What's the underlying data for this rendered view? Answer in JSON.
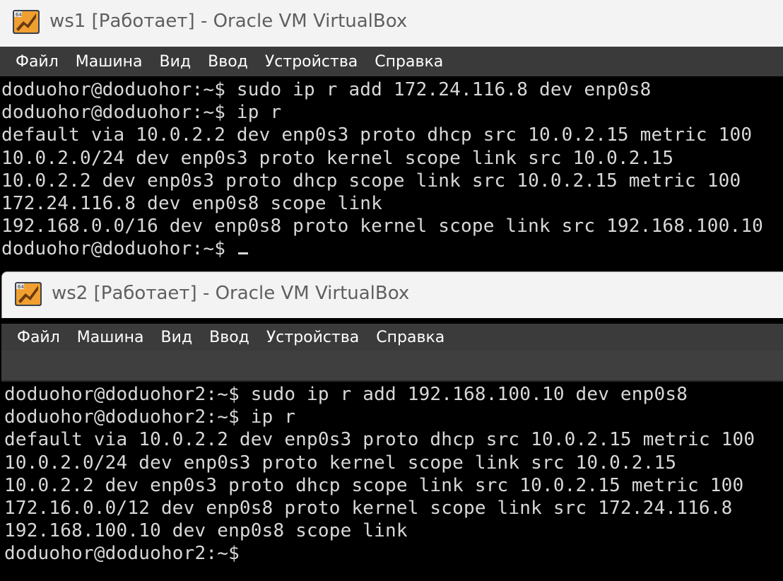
{
  "windows": [
    {
      "title": "ws1 [Работает] - Oracle VM VirtualBox",
      "menu": [
        "Файл",
        "Машина",
        "Вид",
        "Ввод",
        "Устройства",
        "Справка"
      ],
      "terminal": [
        "doduohor@doduohor:~$ sudo ip r add 172.24.116.8 dev enp0s8",
        "doduohor@doduohor:~$ ip r",
        "default via 10.0.2.2 dev enp0s3 proto dhcp src 10.0.2.15 metric 100",
        "10.0.2.0/24 dev enp0s3 proto kernel scope link src 10.0.2.15",
        "10.0.2.2 dev enp0s3 proto dhcp scope link src 10.0.2.15 metric 100",
        "172.24.116.8 dev enp0s8 scope link",
        "192.168.0.0/16 dev enp0s8 proto kernel scope link src 192.168.100.10",
        "doduohor@doduohor:~$ "
      ]
    },
    {
      "title": "ws2 [Работает] - Oracle VM VirtualBox",
      "menu": [
        "Файл",
        "Машина",
        "Вид",
        "Ввод",
        "Устройства",
        "Справка"
      ],
      "terminal": [
        "doduohor@doduohor2:~$ sudo ip r add 192.168.100.10 dev enp0s8",
        "doduohor@doduohor2:~$ ip r",
        "default via 10.0.2.2 dev enp0s3 proto dhcp src 10.0.2.15 metric 100",
        "10.0.2.0/24 dev enp0s3 proto kernel scope link src 10.0.2.15",
        "10.0.2.2 dev enp0s3 proto dhcp scope link src 10.0.2.15 metric 100",
        "172.16.0.0/12 dev enp0s8 proto kernel scope link src 172.24.116.8",
        "192.168.100.10 dev enp0s8 scope link",
        "doduohor@doduohor2:~$"
      ]
    }
  ],
  "icon": "virtualbox-icon",
  "colors": {
    "titlebar_bg": "#f3f3f3",
    "title_text": "#5f5f5f",
    "menubar_bg": "#3a3a3a",
    "terminal_bg": "#000000",
    "terminal_fg": "#d8d8d8"
  }
}
